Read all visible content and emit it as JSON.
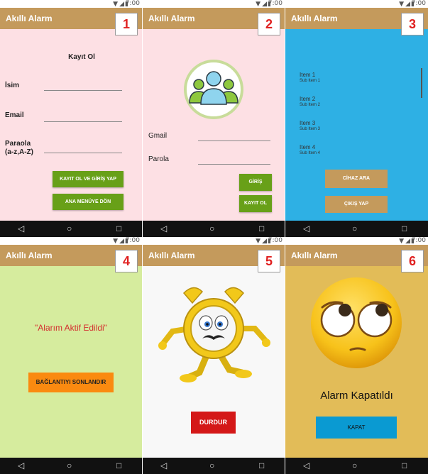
{
  "app_title": "Akıllı Alarm",
  "status_time": "7:00",
  "panels": {
    "p1": {
      "number": "1",
      "form_title": "Kayıt Ol",
      "name_label": "İsim",
      "email_label": "Email",
      "password_label": "Paraola",
      "password_hint": "(a-z,A-Z)",
      "register_button": "KAYIT OL VE GİRİŞ YAP",
      "home_button": "ANA MENÜYE DÖN"
    },
    "p2": {
      "number": "2",
      "gmail_label": "Gmail",
      "password_label": "Parola",
      "login_button": "GİRİŞ",
      "register_button": "KAYIT OL"
    },
    "p3": {
      "number": "3",
      "items": [
        {
          "title": "Item 1",
          "subtitle": "Sub Item 1"
        },
        {
          "title": "Item 2",
          "subtitle": "Sub Item 2"
        },
        {
          "title": "Item 3",
          "subtitle": "Sub Item 3"
        },
        {
          "title": "Item 4",
          "subtitle": "Sub Item 4"
        }
      ],
      "search_button": "CİHAZ ARA",
      "logout_button": "ÇIKIŞ YAP"
    },
    "p4": {
      "number": "4",
      "message": "\"Alarım Aktif Edildi\"",
      "disconnect_button": "BAĞLANTIYI SONLANDIR"
    },
    "p5": {
      "number": "5",
      "stop_button": "DURDUR"
    },
    "p6": {
      "number": "6",
      "message": "Alarm Kapatıldı",
      "close_button": "KAPAT"
    }
  },
  "colors": {
    "appbar": "#c49a5c",
    "panel1_bg": "#fde0e4",
    "panel2_bg": "#fde0e4",
    "panel3_bg": "#2eb0e4",
    "panel4_bg": "#d6ec9e",
    "panel5_bg": "#f8f8f8",
    "panel6_bg": "#e2bc58",
    "green_button": "#68a018",
    "orange_button": "#fa8a10",
    "red_button": "#d41818",
    "blue_button": "#0a9ad2"
  },
  "icons": {
    "status": [
      "wifi-icon",
      "signal-icon",
      "battery-icon"
    ],
    "nav": [
      "back-icon",
      "home-icon",
      "recents-icon"
    ]
  }
}
